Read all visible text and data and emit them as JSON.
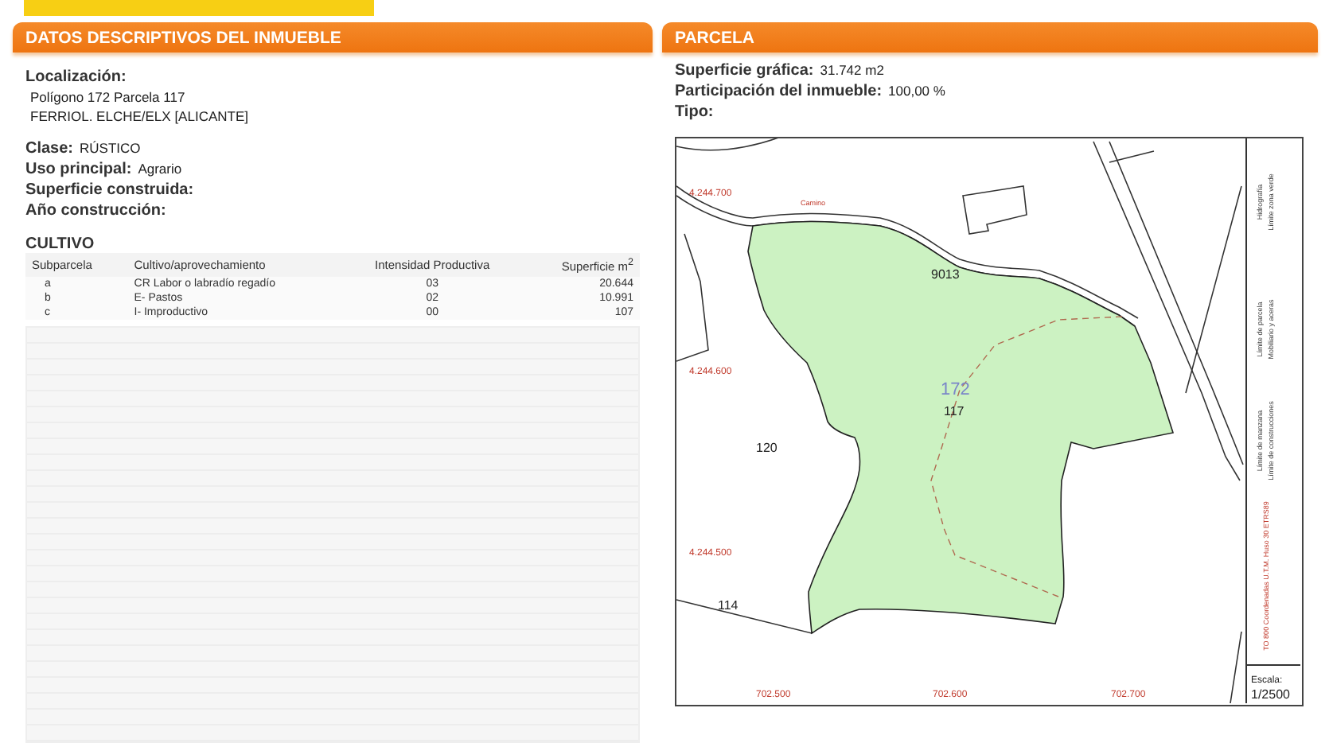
{
  "left_panel": {
    "title": "DATOS DESCRIPTIVOS DEL INMUEBLE",
    "localizacion": {
      "label": "Localización:",
      "lines": [
        "Polígono 172 Parcela 117",
        "FERRIOL. ELCHE/ELX [ALICANTE]"
      ]
    },
    "fields": [
      {
        "label": "Clase:",
        "value": "RÚSTICO"
      },
      {
        "label": "Uso principal:",
        "value": "Agrario"
      },
      {
        "label": "Superficie construida:"
      },
      {
        "label": "Año construcción:"
      }
    ],
    "cultivo": {
      "title": "CULTIVO",
      "columns": [
        "Subparcela",
        "Cultivo/aprovechamiento",
        "Intensidad Productiva",
        "Superficie m$^{2}$"
      ],
      "rows": [
        [
          "a",
          "CR Labor o labradío regadío",
          "03",
          "20.644"
        ],
        [
          "b",
          "E- Pastos",
          "02",
          "10.991"
        ],
        [
          "c",
          "I- Improductivo",
          "00",
          "107"
        ]
      ]
    }
  },
  "right_panel": {
    "title": "PARCELA",
    "fields": [
      {
        "label": "Superficie gráfica:",
        "value": "31.742 m2"
      },
      {
        "label": "Participación del inmueble:",
        "value": "100,00 %"
      },
      {
        "label": "Tipo:"
      }
    ],
    "map": {
      "road_label": "Camino",
      "labels": [
        {
          "text": "9013",
          "kind": "road"
        },
        {
          "text": "172",
          "kind": "polygon"
        },
        {
          "text": "117",
          "kind": "parcel"
        },
        {
          "text": "120",
          "kind": "neighbor"
        },
        {
          "text": "114",
          "kind": "neighbor"
        }
      ],
      "y_coords": [
        "4.244.700",
        "4.244.600",
        "4.244.500"
      ],
      "x_coords": [
        "702.500",
        "702.600",
        "702.700"
      ],
      "legend": [
        "Límite de manzana",
        "Límite de construcciones",
        "Límite de parcela",
        "Mobiliario y aceras",
        "Hidrografía",
        "Límite zona verde"
      ],
      "crs": "TO 800 Coordenadas U.T.M. Huso 30 ETRS89",
      "scale_label": "Escala:",
      "scale": "1/2500"
    }
  }
}
